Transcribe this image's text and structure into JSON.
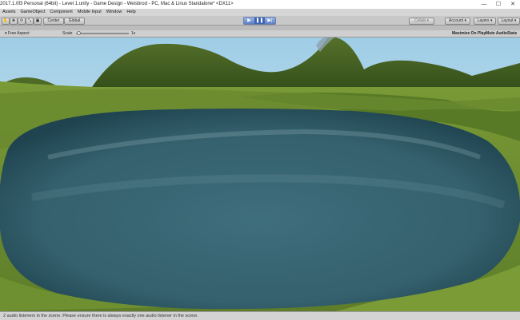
{
  "window": {
    "title": "2017.1.0f3 Personal (64bit) - Level 1.unity - Game Design - Weisbrod - PC, Mac & Linux Standalone* <DX11>",
    "controls": [
      "—",
      "☐",
      "✕"
    ]
  },
  "menu": [
    "Assets",
    "GameObject",
    "Component",
    "Mobile Input",
    "Window",
    "Help"
  ],
  "toolbar": {
    "tools": [
      "✋",
      "✥",
      "⟳",
      "⤡",
      "▣"
    ],
    "pivot_label": "Center",
    "space_label": "Global",
    "collab_label": "Collab ▾",
    "account_label": "Account ▾",
    "layers_label": "Layers ▾",
    "layout_label": "Layout ▾",
    "play": "▶",
    "pause": "❚❚",
    "step": "▶|"
  },
  "game_view": {
    "aspect_label": "Free Aspect",
    "scale_label": "Scale",
    "scale_value": "1x",
    "maximize_label": "Maximize On Play",
    "mute_label": "Mute Audio",
    "stats_label": "Stats",
    "scale_fraction": 0.02
  },
  "status": {
    "message": "2 audio listeners in the scene. Please ensure there is always exactly one audio listener in the scene."
  },
  "colors": {
    "sky": "#cfe6f2",
    "grass": "#6d8a2f",
    "water": "#3a6a7a",
    "play_accent": "#5c7fc4"
  }
}
